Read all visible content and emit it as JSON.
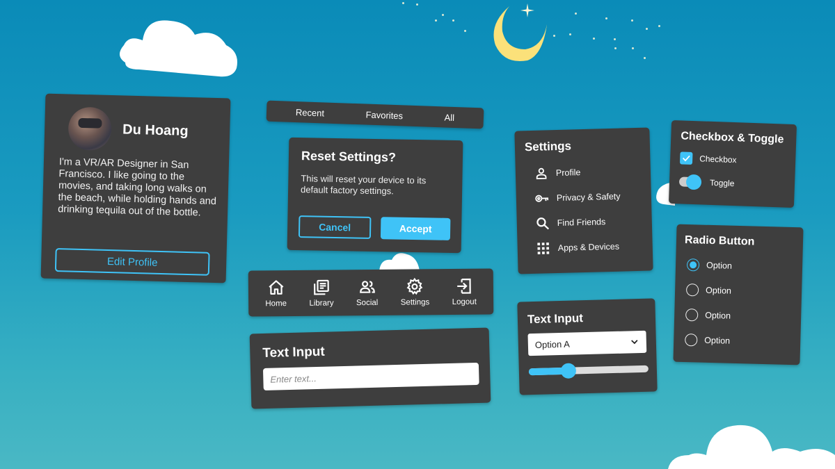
{
  "colors": {
    "accent": "#3fc3f7",
    "panel": "#3e3e3e",
    "sky_top": "#0a8bb8",
    "sky_bottom": "#4ab8c4",
    "moon": "#fbe17a"
  },
  "scene": {
    "decorations": [
      "cloud",
      "cloud",
      "cloud",
      "cloud",
      "crescent-moon",
      "stars"
    ]
  },
  "profile": {
    "name": "Du Hoang",
    "bio": "I'm a VR/AR Designer in San Francisco. I like going to the movies, and taking long walks on the beach, while holding hands and drinking tequila out of the bottle.",
    "edit_label": "Edit Profile"
  },
  "tabs": [
    {
      "label": "Recent"
    },
    {
      "label": "Favorites"
    },
    {
      "label": "All"
    }
  ],
  "dialog": {
    "title": "Reset Settings?",
    "body": "This will reset your device to its default factory settings.",
    "cancel_label": "Cancel",
    "accept_label": "Accept"
  },
  "navbar": {
    "items": [
      {
        "label": "Home",
        "icon": "home-icon"
      },
      {
        "label": "Library",
        "icon": "library-icon"
      },
      {
        "label": "Social",
        "icon": "people-icon"
      },
      {
        "label": "Settings",
        "icon": "gear-icon"
      },
      {
        "label": "Logout",
        "icon": "logout-icon"
      }
    ]
  },
  "text_input": {
    "title": "Text Input",
    "placeholder": "Enter text...",
    "value": ""
  },
  "settings_menu": {
    "title": "Settings",
    "items": [
      {
        "label": "Profile",
        "icon": "person-icon"
      },
      {
        "label": "Privacy & Safety",
        "icon": "key-icon"
      },
      {
        "label": "Find Friends",
        "icon": "search-icon"
      },
      {
        "label": "Apps & Devices",
        "icon": "grid-icon"
      }
    ]
  },
  "dropdown_panel": {
    "title": "Text Input",
    "selected": "Option A",
    "slider_value_percent": 33
  },
  "checkbox_toggle": {
    "title": "Checkbox & Toggle",
    "checkbox_label": "Checkbox",
    "checkbox_checked": true,
    "toggle_label": "Toggle",
    "toggle_on": true
  },
  "radio_group": {
    "title": "Radio Button",
    "options": [
      {
        "label": "Option",
        "selected": true
      },
      {
        "label": "Option",
        "selected": false
      },
      {
        "label": "Option",
        "selected": false
      },
      {
        "label": "Option",
        "selected": false
      }
    ]
  }
}
